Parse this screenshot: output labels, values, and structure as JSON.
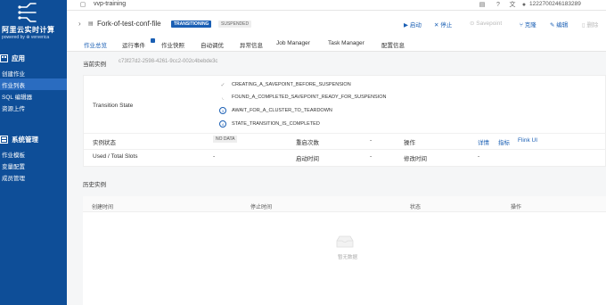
{
  "sidebar": {
    "title": "阿里云实时计算",
    "subtitle": "powered by ⊕ ververica",
    "section_app": "应用",
    "app_items": [
      "创建作业",
      "作业列表",
      "SQL 编辑器",
      "资源上传"
    ],
    "section_sys": "系统管理",
    "sys_items": [
      "作业模板",
      "变量配置",
      "成员管理"
    ]
  },
  "topbar": {
    "project": "vvp-training",
    "account": "1222700246183289"
  },
  "job": {
    "title": "Fork-of-test-conf-file",
    "state_badge": "TRANSITIONING",
    "target_badge": "SUSPENDED",
    "actions": {
      "start": "启动",
      "stop": "停止",
      "savepoint": "Savepoint",
      "clone": "克隆",
      "edit": "编辑",
      "delete": "删除"
    }
  },
  "tabs": [
    "作业总览",
    "运行事件",
    "作业快照",
    "自动调优",
    "异常信息",
    "Job Manager",
    "Task Manager",
    "配置信息"
  ],
  "instance": {
    "label": "当前实例",
    "id": "c73f27d2-2598-4261-9cc2-002c4bebde3c"
  },
  "transition": {
    "label": "Transition State",
    "steps": [
      "CREATING_A_SAVEPOINT_BEFORE_SUSPENSION",
      "FOUND_A_COMPLETED_SAVEPOINT_READY_FOR_SUSPENSION",
      "AWAIT_FOR_A_CLUSTER_TO_TEARDOWN",
      "STATE_TRANSITION_IS_COMPLETED"
    ]
  },
  "details": {
    "instance_state_label": "实例状态",
    "instance_state_value": "NO DATA",
    "restart_label": "重启次数",
    "restart_value": "-",
    "ops_label": "操作",
    "op_details": "详情",
    "op_metrics": "指标",
    "op_flink_ui": "Flink UI",
    "slots_label": "Used / Total Slots",
    "slots_value": "-",
    "start_time_label": "启动时间",
    "start_time_value": "-",
    "mod_time_label": "修改时间",
    "mod_time_value": "-"
  },
  "history": {
    "title": "历史实例",
    "columns": [
      "创建时间",
      "停止时间",
      "状态",
      "操作"
    ],
    "empty_text": "暂无数据"
  },
  "colors": {
    "sidebar": "#0e4e98",
    "accent": "#1a5fb4"
  }
}
